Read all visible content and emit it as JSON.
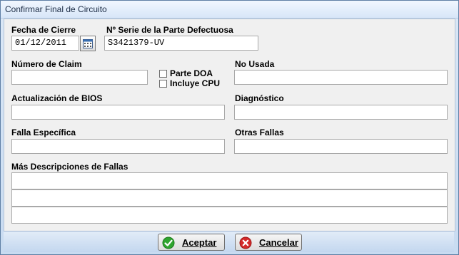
{
  "window": {
    "title": "Confirmar Final de Circuito"
  },
  "fields": {
    "fecha_cierre": {
      "label": "Fecha de Cierre",
      "value": "01/12/2011"
    },
    "serie": {
      "label": "Nº Serie de la Parte Defectuosa",
      "value": "S3421379-UV"
    },
    "claim": {
      "label": "Número de Claim",
      "value": ""
    },
    "no_usada": {
      "label": "No Usada",
      "value": ""
    },
    "bios": {
      "label": "Actualización de BIOS",
      "value": ""
    },
    "diagnostico": {
      "label": "Diagnóstico",
      "value": ""
    },
    "falla": {
      "label": "Falla Específica",
      "value": ""
    },
    "otras": {
      "label": "Otras Fallas",
      "value": ""
    },
    "mas": {
      "label": "Más Descripciones de Fallas",
      "lines": [
        "",
        "",
        ""
      ]
    }
  },
  "checkboxes": {
    "parte_doa": {
      "label": "Parte DOA",
      "checked": false
    },
    "incluye_cpu": {
      "label": "Incluye CPU",
      "checked": false
    }
  },
  "buttons": {
    "accept": "Aceptar",
    "cancel": "Cancelar"
  },
  "icons": {
    "calendar": "calendar-icon",
    "accept": "checkmark-icon",
    "cancel": "close-icon"
  },
  "colors": {
    "accept_icon": "#2fa52f",
    "cancel_icon": "#d42a2a"
  }
}
